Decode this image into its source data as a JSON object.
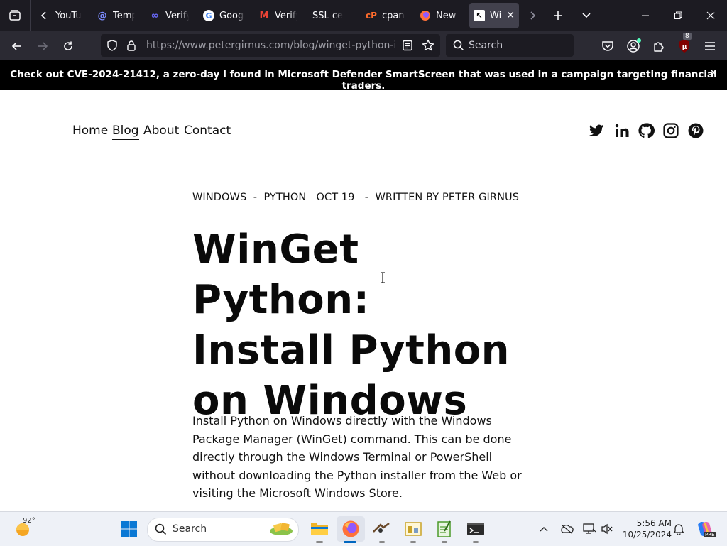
{
  "browser": {
    "tabs": [
      {
        "label": "YouTu",
        "icon": "youtube-icon"
      },
      {
        "label": "Temp",
        "icon": "at-sign-icon"
      },
      {
        "label": "Verify",
        "icon": "infinity-icon"
      },
      {
        "label": "Googl",
        "icon": "google-icon"
      },
      {
        "label": "Verify",
        "icon": "gmail-icon"
      },
      {
        "label": "SSL ce",
        "icon": "ssl-icon"
      },
      {
        "label": "cpane",
        "icon": "cpanel-icon"
      },
      {
        "label": "New T",
        "icon": "firefox-icon"
      },
      {
        "label": "Wi",
        "icon": "cursor-icon",
        "active": true
      }
    ],
    "url_host": "https://www.petergirnus.com",
    "url_path": "/blog/winget-python-install",
    "search_placeholder": "Search",
    "extensions_badge": "8",
    "colors": {
      "tabbar": "#1c1b22",
      "navbar": "#2b2a33",
      "accent": "#0060df"
    }
  },
  "banner": {
    "text": "Check out CVE-2024-21412, a zero-day I found in Microsoft Defender SmartScreen that was used in a campaign targeting financial traders.",
    "close": "×"
  },
  "site_nav": {
    "items": [
      "Home",
      "Blog",
      "About",
      "Contact"
    ],
    "active": "Blog",
    "social": [
      "twitter-icon",
      "linkedin-icon",
      "github-icon",
      "instagram-icon",
      "pinterest-icon"
    ]
  },
  "article": {
    "category1": "WINDOWS",
    "sep1": "-",
    "category2": "PYTHON",
    "date": "OCT 19",
    "sep2": "-",
    "author": "WRITTEN BY PETER GIRNUS",
    "title_lines": [
      "WinGet Python:",
      "Install Python",
      "on Windows"
    ],
    "intro": "Install Python on Windows directly with the Windows Package Manager (WinGet) command. This can be done directly through the Windows Terminal or PowerShell without downloading the Python installer from the Web or visiting the Microsoft Windows Store."
  },
  "taskbar": {
    "weather_temp": "92°",
    "search_placeholder": "Search",
    "time": "5:56 AM",
    "date": "10/25/2024",
    "copilot_badge": "PRE"
  }
}
